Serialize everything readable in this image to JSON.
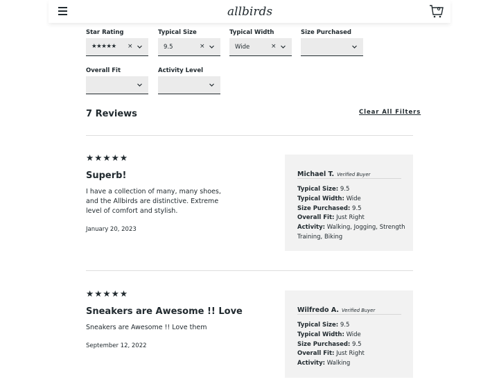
{
  "header": {
    "brand": "allbirds",
    "cart_count": "0"
  },
  "filters": {
    "star_rating": {
      "label": "Star Rating",
      "value": "★★★★★"
    },
    "typical_size": {
      "label": "Typical Size",
      "value": "9.5"
    },
    "typical_width": {
      "label": "Typical Width",
      "value": "Wide"
    },
    "size_purchased": {
      "label": "Size Purchased",
      "value": ""
    },
    "overall_fit": {
      "label": "Overall Fit",
      "value": ""
    },
    "activity_level": {
      "label": "Activity Level",
      "value": ""
    },
    "clear_icon": "×"
  },
  "reviews_header": {
    "count_text": "7 Reviews",
    "clear_all": "Clear All Filters"
  },
  "reviews": [
    {
      "stars": "★★★★★",
      "rating": 5,
      "title": "Superb!",
      "body": "I have a collection of many, many shoes, and the Allbirds are distinctive. Extreme level of comfort and stylish.",
      "date": "January 20, 2023",
      "author": "Michael T.",
      "verified": "Verified Buyer",
      "attrs": [
        {
          "label": "Typical Size:",
          "value": "9.5"
        },
        {
          "label": "Typical Width:",
          "value": "Wide"
        },
        {
          "label": "Size Purchased:",
          "value": "9.5"
        },
        {
          "label": "Overall Fit:",
          "value": "Just Right"
        },
        {
          "label": "Activity:",
          "value": "Walking, Jogging, Strength Training, Biking"
        }
      ]
    },
    {
      "stars": "★★★★★",
      "rating": 5,
      "title": "Sneakers are Awesome !! Love",
      "body": "Sneakers are Awesome !! Love them",
      "date": "September 12, 2022",
      "author": "Wilfredo A.",
      "verified": "Verified Buyer",
      "attrs": [
        {
          "label": "Typical Size:",
          "value": "9.5"
        },
        {
          "label": "Typical Width:",
          "value": "Wide"
        },
        {
          "label": "Size Purchased:",
          "value": "9.5"
        },
        {
          "label": "Overall Fit:",
          "value": "Just Right"
        },
        {
          "label": "Activity:",
          "value": "Walking"
        }
      ]
    }
  ]
}
